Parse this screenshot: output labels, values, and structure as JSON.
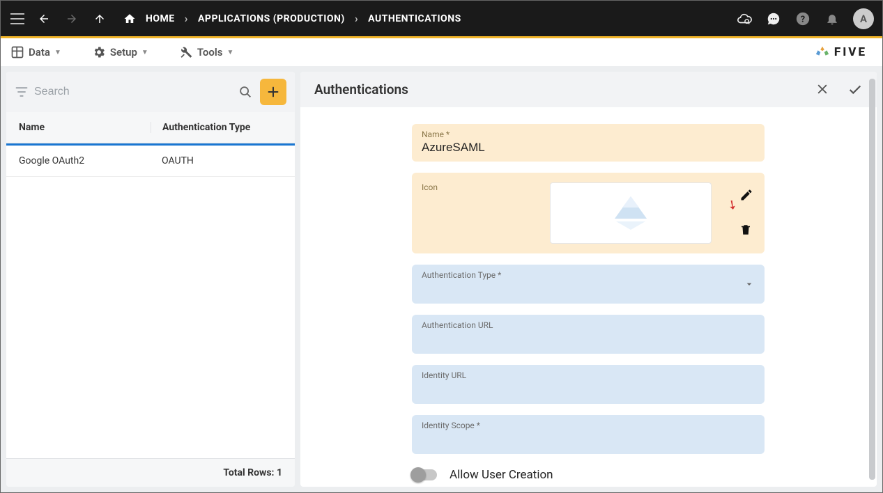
{
  "topbar": {
    "breadcrumbs": [
      "HOME",
      "APPLICATIONS (PRODUCTION)",
      "AUTHENTICATIONS"
    ],
    "avatar_initial": "A"
  },
  "menubar": {
    "items": [
      "Data",
      "Setup",
      "Tools"
    ],
    "logo_text": "FIVE"
  },
  "left": {
    "search_placeholder": "Search",
    "columns": [
      "Name",
      "Authentication Type"
    ],
    "rows": [
      {
        "name": "Google OAuth2",
        "type": "OAUTH"
      }
    ],
    "footer_label": "Total Rows:",
    "footer_count": "1"
  },
  "right": {
    "title": "Authentications",
    "form": {
      "name_label": "Name *",
      "name_value": "AzureSAML",
      "icon_label": "Icon",
      "auth_type_label": "Authentication Type *",
      "auth_url_label": "Authentication URL",
      "identity_url_label": "Identity URL",
      "identity_scope_label": "Identity Scope *",
      "allow_user_creation_label": "Allow User Creation"
    }
  }
}
